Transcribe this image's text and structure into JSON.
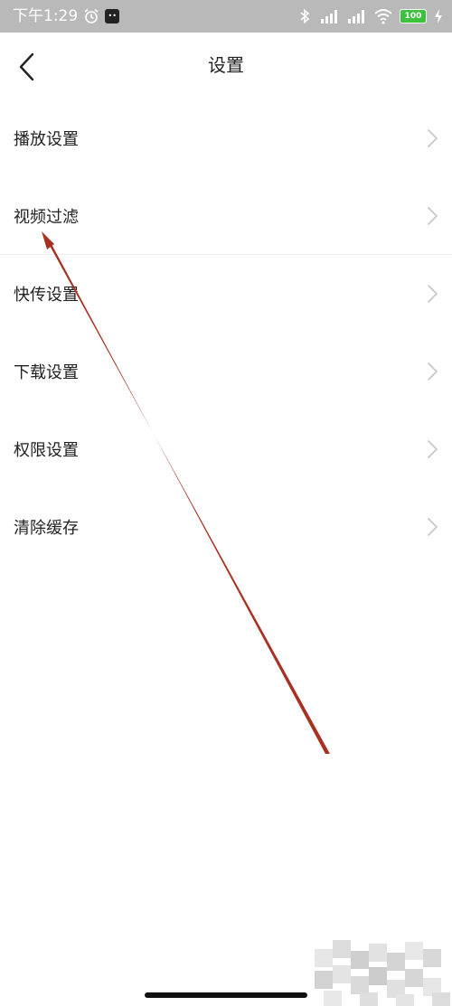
{
  "status_bar": {
    "time": "下午1:29",
    "battery": "100",
    "icons": [
      "alarm-icon",
      "app-badge",
      "bluetooth-icon",
      "signal-icon",
      "signal-icon",
      "wifi-icon",
      "battery-icon",
      "charging-icon"
    ]
  },
  "header": {
    "title": "设置",
    "back_icon": "chevron-left-icon"
  },
  "settings": {
    "items": [
      {
        "label": "播放设置"
      },
      {
        "label": "视频过滤"
      },
      {
        "label": "快传设置"
      },
      {
        "label": "下载设置"
      },
      {
        "label": "权限设置"
      },
      {
        "label": "清除缓存"
      }
    ],
    "item_icon": "chevron-right-icon"
  },
  "colors": {
    "status_bar_bg": "#b9b9b9",
    "text": "#222222",
    "chevron": "#c8c8c8",
    "annotation": "#a83222",
    "battery": "#3ec23e"
  }
}
